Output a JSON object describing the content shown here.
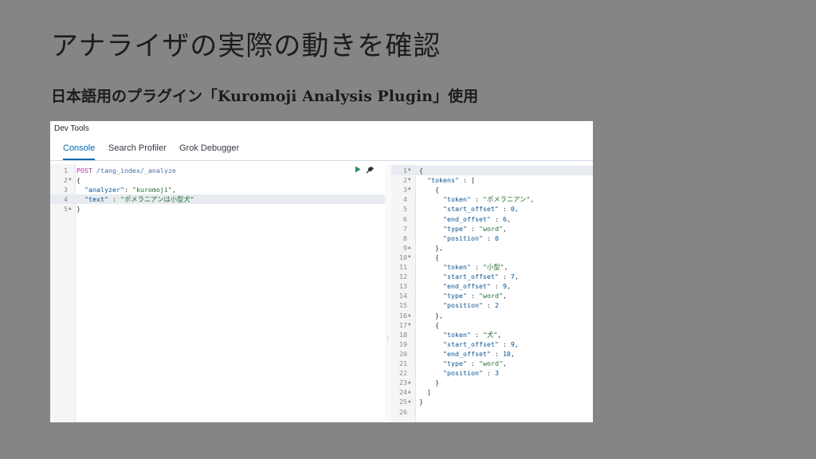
{
  "slide": {
    "title": "アナライザの実際の動きを確認",
    "subtitle": "日本語用のプラグイン「Kuromoji Analysis Plugin」使用"
  },
  "devtools": {
    "header": "Dev Tools",
    "tabs": [
      "Console",
      "Search Profiler",
      "Grok Debugger"
    ],
    "active_tab": "Console",
    "request": {
      "method": "POST",
      "path": "/tang_index/_analyze",
      "lines": [
        {
          "n": "1",
          "fold": "",
          "text": ""
        },
        {
          "n": "2",
          "fold": "▼",
          "text": "{"
        },
        {
          "n": "3",
          "fold": "",
          "text": "  \"analyzer\": \"kuromoji\","
        },
        {
          "n": "4",
          "fold": "",
          "text": "  \"text\" : \"ポメラニアンは小型犬\""
        },
        {
          "n": "5",
          "fold": "▲",
          "text": "}"
        }
      ]
    },
    "response": {
      "lines": [
        {
          "n": "1",
          "fold": "▼",
          "text": "{"
        },
        {
          "n": "2",
          "fold": "▼",
          "text": "  \"tokens\" : ["
        },
        {
          "n": "3",
          "fold": "▼",
          "text": "    {"
        },
        {
          "n": "4",
          "fold": "",
          "text": "      \"token\" : \"ポメラニアン\","
        },
        {
          "n": "5",
          "fold": "",
          "text": "      \"start_offset\" : 0,"
        },
        {
          "n": "6",
          "fold": "",
          "text": "      \"end_offset\" : 6,"
        },
        {
          "n": "7",
          "fold": "",
          "text": "      \"type\" : \"word\","
        },
        {
          "n": "8",
          "fold": "",
          "text": "      \"position\" : 0"
        },
        {
          "n": "9",
          "fold": "▲",
          "text": "    },"
        },
        {
          "n": "10",
          "fold": "▼",
          "text": "    {"
        },
        {
          "n": "11",
          "fold": "",
          "text": "      \"token\" : \"小型\","
        },
        {
          "n": "12",
          "fold": "",
          "text": "      \"start_offset\" : 7,"
        },
        {
          "n": "13",
          "fold": "",
          "text": "      \"end_offset\" : 9,"
        },
        {
          "n": "14",
          "fold": "",
          "text": "      \"type\" : \"word\","
        },
        {
          "n": "15",
          "fold": "",
          "text": "      \"position\" : 2"
        },
        {
          "n": "16",
          "fold": "▲",
          "text": "    },"
        },
        {
          "n": "17",
          "fold": "▼",
          "text": "    {"
        },
        {
          "n": "18",
          "fold": "",
          "text": "      \"token\" : \"犬\","
        },
        {
          "n": "19",
          "fold": "",
          "text": "      \"start_offset\" : 9,"
        },
        {
          "n": "20",
          "fold": "",
          "text": "      \"end_offset\" : 10,"
        },
        {
          "n": "21",
          "fold": "",
          "text": "      \"type\" : \"word\","
        },
        {
          "n": "22",
          "fold": "",
          "text": "      \"position\" : 3"
        },
        {
          "n": "23",
          "fold": "▲",
          "text": "    }"
        },
        {
          "n": "24",
          "fold": "▲",
          "text": "  ]"
        },
        {
          "n": "25",
          "fold": "▲",
          "text": "}"
        },
        {
          "n": "26",
          "fold": "",
          "text": ""
        }
      ]
    },
    "icons": {
      "run": "play-icon",
      "settings": "wrench-icon",
      "resize": "resize-handle-icon"
    }
  }
}
